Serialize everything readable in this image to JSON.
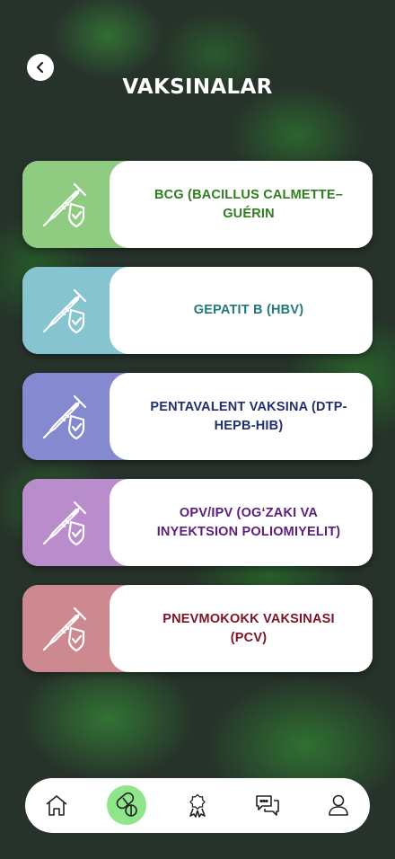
{
  "header": {
    "title": "VAKSINALAR"
  },
  "vaccines": [
    {
      "label": "BCG (BACILLUS CALMETTE–GUÉRIN",
      "icon": "syringe-shield-icon",
      "color": "#8fcc82",
      "text_color": "#2e7d1e"
    },
    {
      "label": "GEPATIT B (HBV)",
      "icon": "syringe-shield-icon",
      "color": "#86c5cf",
      "text_color": "#1f7a78"
    },
    {
      "label": "PENTAVALENT VAKSINA (DTP-HEPB-HIB)",
      "icon": "syringe-shield-icon",
      "color": "#8589cf",
      "text_color": "#23306e"
    },
    {
      "label": "OPV/IPV (OGʻZAKI VA INYEKTSION POLIOMIYELIT)",
      "icon": "syringe-shield-icon",
      "color": "#b98ccb",
      "text_color": "#5b1f7a"
    },
    {
      "label": "PNEVMOKOKK VAKSINASI (PCV)",
      "icon": "syringe-shield-icon",
      "color": "#cc8a90",
      "text_color": "#7a1428"
    }
  ],
  "nav": {
    "items": [
      {
        "name": "home",
        "icon": "home-icon"
      },
      {
        "name": "vaccines",
        "icon": "pills-icon",
        "active": true
      },
      {
        "name": "awards",
        "icon": "award-icon"
      },
      {
        "name": "chat",
        "icon": "chat-icon"
      },
      {
        "name": "profile",
        "icon": "user-icon"
      }
    ],
    "active_color": "#8fe58a"
  }
}
